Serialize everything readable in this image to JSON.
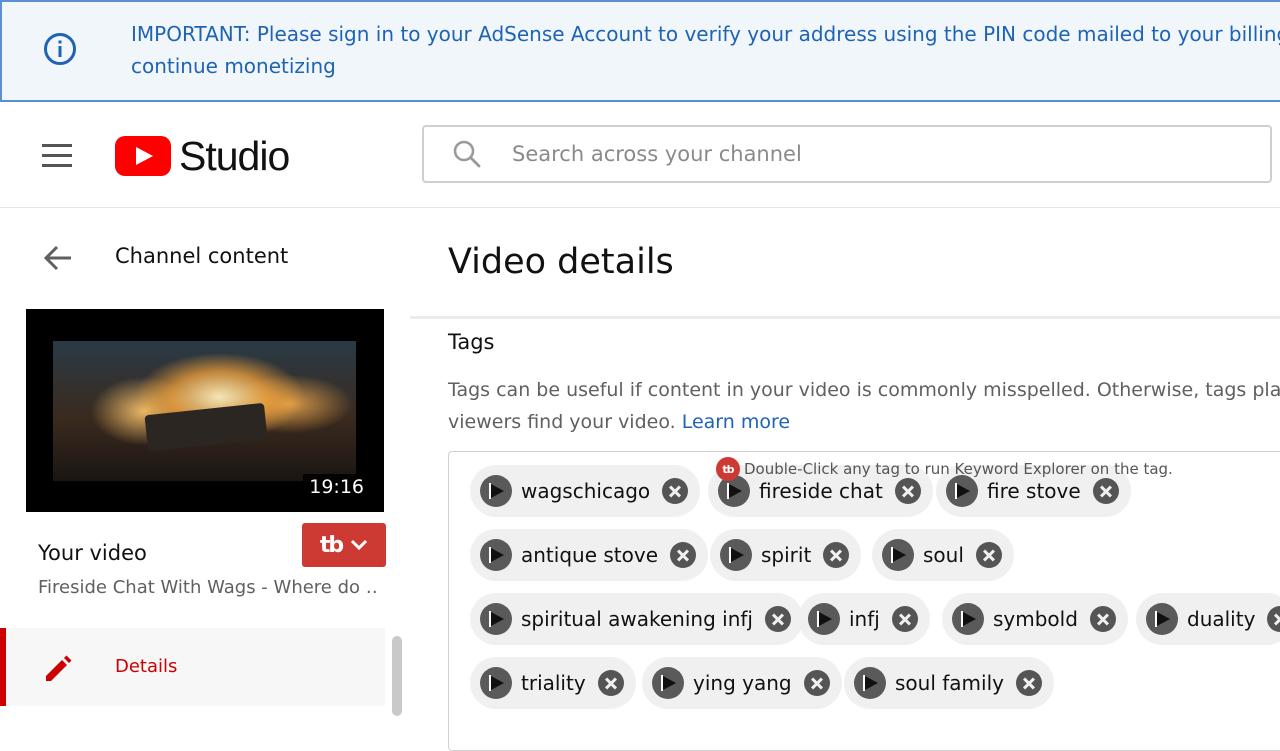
{
  "banner": {
    "icon": "info-icon",
    "message_line1": "IMPORTANT: Please sign in to your AdSense Account to verify your address using the PIN code mailed to your billing address to",
    "message_line2": "continue monetizing"
  },
  "header": {
    "logo_text": "Studio",
    "search_placeholder": "Search across your channel"
  },
  "sidebar": {
    "back_label": "Channel content",
    "duration": "19:16",
    "your_video_label": "Your video",
    "video_title": "Fireside Chat With Wags - Where do …",
    "nav_items": [
      {
        "label": "Details",
        "icon": "pencil-icon",
        "active": true
      }
    ]
  },
  "main": {
    "title": "Video details",
    "tags_title": "Tags",
    "tags_desc_line1": "Tags can be useful if content in your video is commonly misspelled. Otherwise, tags play a",
    "tags_desc_line2": "viewers find your video. ",
    "learn_more": "Learn more",
    "tubebuddy_hint": "Double-Click any tag to run Keyword Explorer on the tag.",
    "tags": [
      "wagschicago",
      "fireside chat",
      "fire stove",
      "antique stove",
      "spirit",
      "soul",
      "spiritual awakening infj",
      "infj",
      "symbold",
      "duality",
      "triality",
      "ying yang",
      "soul family"
    ]
  },
  "colors": {
    "accent_red": "#cc0000",
    "tubebuddy_red": "#cc3a33",
    "link_blue": "#1f63b5",
    "banner_border": "#5b8fd1"
  }
}
